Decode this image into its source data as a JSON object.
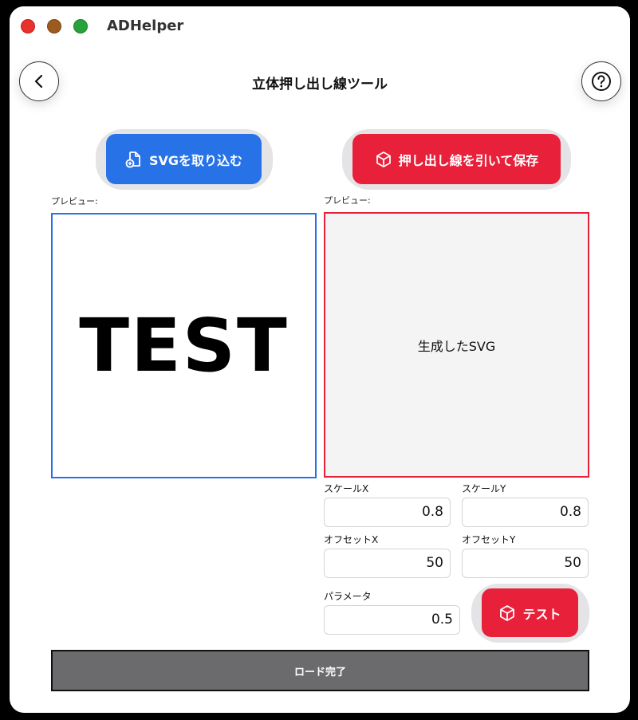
{
  "app": {
    "title": "ADHelper"
  },
  "header": {
    "title": "立体押し出し線ツール"
  },
  "toolbar": {
    "import_label": "SVGを取り込む",
    "extrude_label": "押し出し線を引いて保存"
  },
  "left_panel": {
    "preview_label": "プレビュー:",
    "preview_text": "TEST"
  },
  "right_panel": {
    "preview_label": "プレビュー:",
    "placeholder_text": "生成したSVG"
  },
  "params": {
    "scale_x": {
      "label": "スケールX",
      "value": "0.8"
    },
    "scale_y": {
      "label": "スケールY",
      "value": "0.8"
    },
    "offset_x": {
      "label": "オフセットX",
      "value": "50"
    },
    "offset_y": {
      "label": "オフセットY",
      "value": "50"
    },
    "parameter": {
      "label": "パラメータ",
      "value": "0.5"
    }
  },
  "test_button": {
    "label": "テスト"
  },
  "status": {
    "text": "ロード完了"
  },
  "colors": {
    "accent_blue": "#2772e6",
    "accent_red": "#e8203a",
    "status_bg": "#6b6b6d"
  },
  "icons": {
    "back": "chevron-left-icon",
    "help": "question-circle-icon",
    "import": "file-add-icon",
    "extrude": "cube-icon",
    "test": "cube-icon"
  }
}
